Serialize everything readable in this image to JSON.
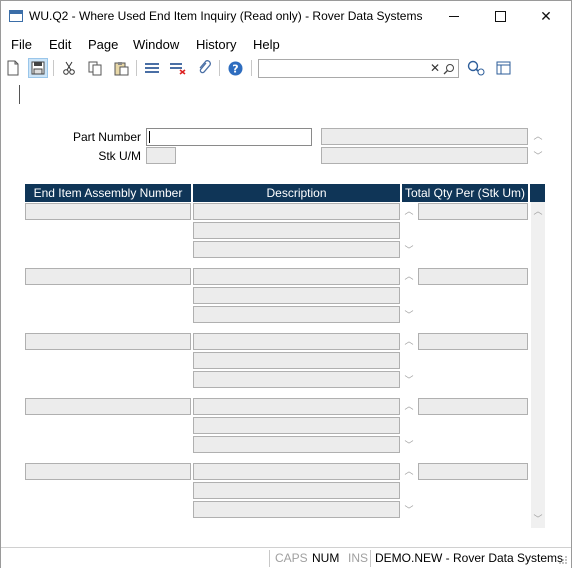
{
  "window": {
    "title": "WU.Q2 - Where Used End Item Inquiry (Read only) - Rover Data Systems",
    "minimize": "minimize",
    "maximize": "maximize",
    "close": "✕"
  },
  "menu": [
    "File",
    "Edit",
    "Page",
    "Window",
    "History",
    "Help"
  ],
  "toolbar": {
    "buttons": [
      "new-document-icon",
      "save-icon",
      "cut-icon",
      "copy-icon",
      "paste-icon",
      "insert-row-icon",
      "delete-row-icon",
      "attach-icon",
      "help-icon",
      "zoom-icon",
      "layout-icon"
    ],
    "search": {
      "value": "",
      "placeholder": "",
      "clear": "✕"
    }
  },
  "form": {
    "part_number_label": "Part Number",
    "part_number_value": "",
    "stk_um_label": "Stk U/M",
    "stk_um_value": ""
  },
  "grid": {
    "columns": [
      "End Item Assembly Number",
      "Description",
      "Total Qty Per (Stk Um)"
    ],
    "rows": [
      {
        "assembly": "",
        "description": [
          "",
          "",
          ""
        ],
        "qty": ""
      },
      {
        "assembly": "",
        "description": [
          "",
          "",
          ""
        ],
        "qty": ""
      },
      {
        "assembly": "",
        "description": [
          "",
          "",
          ""
        ],
        "qty": ""
      },
      {
        "assembly": "",
        "description": [
          "",
          "",
          ""
        ],
        "qty": ""
      },
      {
        "assembly": "",
        "description": [
          "",
          "",
          ""
        ],
        "qty": ""
      }
    ]
  },
  "status": {
    "caps": "CAPS",
    "num": "NUM",
    "ins": "INS",
    "info": "DEMO.NEW - Rover Data Systems"
  },
  "colors": {
    "header_bg": "#0f3557",
    "field_bg": "#ececec",
    "field_border": "#b0b0b0"
  }
}
